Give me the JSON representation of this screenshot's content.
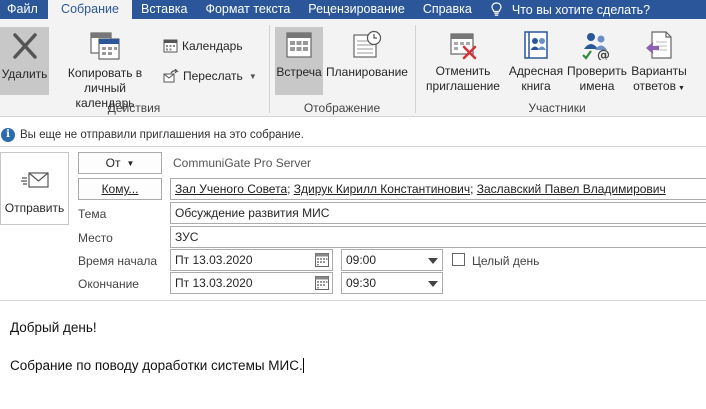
{
  "tabs": [
    {
      "label": "Файл",
      "active": false
    },
    {
      "label": "Собрание",
      "active": true
    },
    {
      "label": "Вставка",
      "active": false
    },
    {
      "label": "Формат текста",
      "active": false
    },
    {
      "label": "Рецензирование",
      "active": false
    },
    {
      "label": "Справка",
      "active": false
    }
  ],
  "tell_me": "Что вы хотите сделать?",
  "ribbon": {
    "actions": {
      "delete": "Удалить",
      "copy_l1": "Копировать в",
      "copy_l2": "личный календарь",
      "calendar": "Календарь",
      "forward": "Переслать",
      "group": "Действия"
    },
    "display": {
      "meeting": "Встреча",
      "planning": "Планирование",
      "group": "Отображение"
    },
    "attendees": {
      "cancel_l1": "Отменить",
      "cancel_l2": "приглашение",
      "book_l1": "Адресная",
      "book_l2": "книга",
      "check_l1": "Проверить",
      "check_l2": "имена",
      "resp_l1": "Варианты",
      "resp_l2": "ответов",
      "group": "Участники"
    }
  },
  "info_message": "Вы еще не отправили приглашения на это собрание.",
  "form": {
    "send_label": "Отправить",
    "from_label": "От",
    "from_value": "CommuniGate Pro Server",
    "to_label": "Кому...",
    "recipients": [
      "Зал Ученого Совета",
      "Здирук Кирилл Константинович",
      "Заславский Павел Владимирович"
    ],
    "subject_label": "Тема",
    "subject_value": "Обсуждение развития МИС",
    "location_label": "Место",
    "location_value": "ЗУС",
    "start_label": "Время начала",
    "start_date": "Пт 13.03.2020",
    "start_time": "09:00",
    "allday_label": "Целый день",
    "allday_checked": false,
    "end_label": "Окончание",
    "end_date": "Пт 13.03.2020",
    "end_time": "09:30"
  },
  "body": {
    "line1": "Добрый день!",
    "line2": "Собрание по поводу доработки системы МИС."
  }
}
